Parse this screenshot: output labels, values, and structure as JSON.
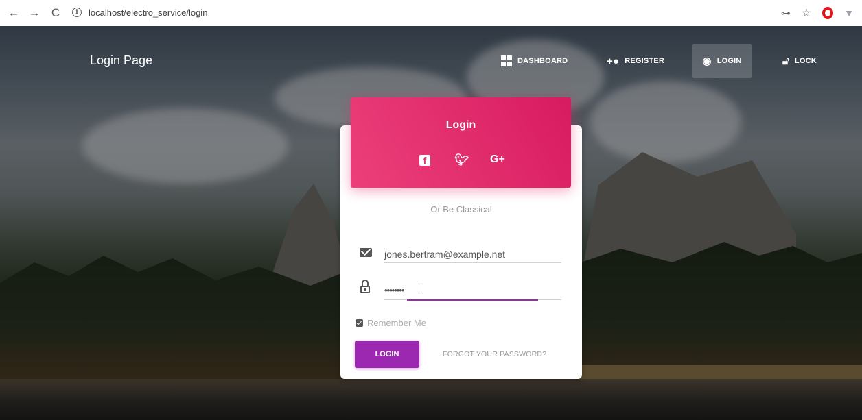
{
  "browser": {
    "url": "localhost/electro_service/login",
    "back_glyph": "←",
    "forward_glyph": "→",
    "reload_glyph": "C"
  },
  "navbar": {
    "brand": "Login Page",
    "items": [
      {
        "label": "DASHBOARD",
        "icon": "dashboard-icon"
      },
      {
        "label": "REGISTER",
        "icon": "add-person-icon"
      },
      {
        "label": "LOGIN",
        "icon": "fingerprint-icon",
        "active": true
      },
      {
        "label": "LOCK",
        "icon": "lock-icon"
      }
    ]
  },
  "card": {
    "title": "Login",
    "social": [
      "facebook-icon",
      "twitter-icon",
      "google-plus-icon"
    ],
    "divider_text": "Or Be Classical",
    "email_value": "jones.bertram@example.net",
    "password_mask": "••••••••",
    "remember_label": "Remember Me",
    "remember_checked": true,
    "login_button": "LOGIN",
    "forgot_link": "FORGOT YOUR PASSWORD?"
  },
  "colors": {
    "header_pink": "#e91e63",
    "button_purple": "#9c27b0"
  }
}
